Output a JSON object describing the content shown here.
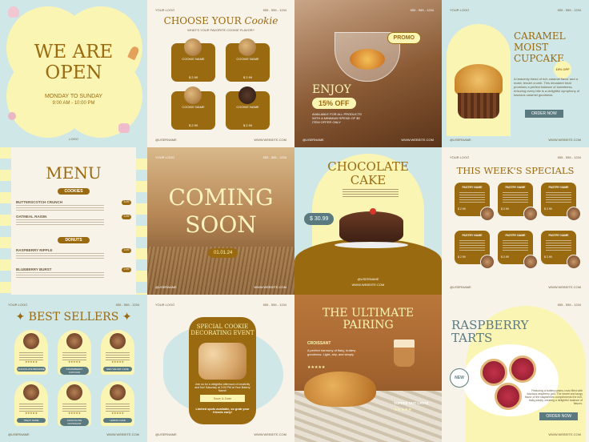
{
  "tile1": {
    "heading_line1": "WE ARE",
    "heading_line2": "OPEN",
    "days": "MONDAY TO SUNDAY",
    "hours": "9:00 AM - 10:00 PM",
    "logo": "LOGO"
  },
  "tile2": {
    "logo": "YOUR LOGO",
    "phone": "555 - 555 - 1234",
    "title_prefix": "CHOOSE YOUR",
    "title_script": "Cookie",
    "subtitle": "WHAT'S YOUR FAVORITE COOKIE FLAVOR?",
    "card_label": "COOKIE NAME",
    "price": "$ 2.99",
    "username": "@USERNAME",
    "website": "WWW.WEBSITE.COM"
  },
  "tile3": {
    "phone": "555 - 555 - 1234",
    "promo": "PROMO",
    "enjoy": "ENJOY",
    "discount": "15% OFF",
    "fine_print": "AVAILABLE FOR ALL PRODUCTS WITH A MINIMUM SPEND OF $0 ITEM OFFER ONLY",
    "username": "@USERNAME",
    "website": "WWW.WEBSITE.COM"
  },
  "tile4": {
    "logo": "YOUR LOGO",
    "phone": "555 - 555 - 1234",
    "title_line1": "CARAMEL MOIST",
    "title_line2": "CUPCAKE",
    "discount": "15% OFF",
    "body": "A heavenly blend of rich caramel flavor and a moist, tender crumb. This decadent treat promises a perfect balance of sweetness, ensuring every bite is a delightful symphony of luscious caramel goodness.",
    "button": "ORDER NOW",
    "username": "@USERNAME",
    "website": "WWW.WEBSITE.COM"
  },
  "tile5": {
    "title": "MENU",
    "sec1": "COOKIES",
    "items1": [
      {
        "name": "BUTTERSCOTCH CRUNCH",
        "price": "5.99"
      },
      {
        "name": "OATMEAL RAISIN",
        "price": "3.99"
      }
    ],
    "sec2": "DONUTS",
    "items2": [
      {
        "name": "RASPBERRY RIPPLE",
        "price": "3.99"
      },
      {
        "name": "BLUEBERRY BURST",
        "price": "2.99"
      }
    ]
  },
  "tile6": {
    "logo": "YOUR LOGO",
    "phone": "555 - 555 - 1234",
    "line1": "COMING",
    "line2": "SOON",
    "date": "01.01.24",
    "username": "@USERNAME",
    "website": "WWW.WEBSITE.COM"
  },
  "tile7": {
    "title_line1": "CHOCOLATE",
    "title_line2": "CAKE",
    "price": "$ 30.99",
    "username": "@USERNAME",
    "website": "WWW.WEBSITE.COM"
  },
  "tile8": {
    "logo": "YOUR LOGO",
    "phone": "555 - 555 - 1234",
    "title": "THIS WEEK'S SPECIALS",
    "card_label": "PASTRY NAME",
    "price": "$ 2.99",
    "username": "@USERNAME",
    "website": "WWW.WEBSITE.COM"
  },
  "tile9": {
    "logo": "YOUR LOGO",
    "phone": "555 - 555 - 1234",
    "title": "BEST SELLERS",
    "items": [
      "CHOCOLATE BROWNIE",
      "STRAWBERRY CUPCAKE",
      "RED VELVET CAKE",
      "TREAT NAME",
      "CHOCOLATE CROISSANT",
      "LEMON CAKE"
    ],
    "username": "@USERNAME",
    "website": "WWW.WEBSITE.COM"
  },
  "tile10": {
    "logo": "YOUR LOGO",
    "phone": "555 - 555 - 1234",
    "title_line1": "SPECIAL COOKIE",
    "title_line2": "DECORATING EVENT",
    "details": "Join us for a delightful afternoon of creativity and fun! Saturday at 3:00 PM at Your Bakery Name!",
    "button": "Save & Date",
    "spots": "Limited spots available, so grab your friends early!",
    "username": "@USERNAME",
    "website": "WWW.WEBSITE.COM"
  },
  "tile11": {
    "title_line1": "THE ULTIMATE",
    "title_line2": "PAIRING",
    "item1": "CROISSANT",
    "item1_desc": "A perfect harmony of flaky, buttery goodness. Light, airy, and simply",
    "item2": "TOFFEE NUT LATTE"
  },
  "tile12": {
    "phone": "555 - 555 - 1234",
    "title_line1": "RASPBERRY",
    "title_line2": "TARTS",
    "badge": "NEW",
    "body": "Featuring a buttery pastry crust filled with luscious raspberry jam. The sweet and tangy flavor of the raspberries complements the rich, flaky pastry, creating a delightful balance of flavors.",
    "button": "ORDER NOW",
    "website": "WWW.WEBSITE.COM"
  },
  "colors": {
    "brown": "#9a6a10",
    "yellow": "#fbf5b4",
    "mint": "#cfe7e6",
    "cream": "#f8f3e9"
  }
}
